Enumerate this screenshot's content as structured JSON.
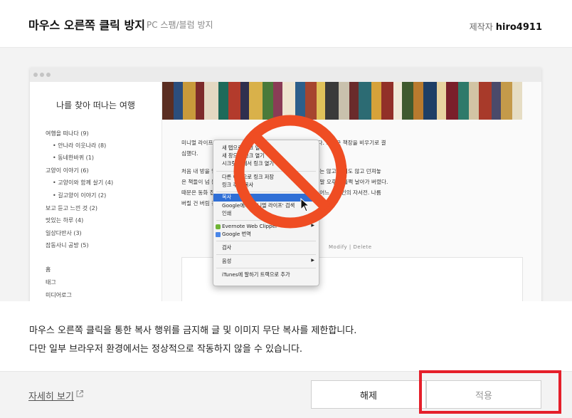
{
  "header": {
    "title": "마우스 오른쪽 클릭 방지",
    "subtitle": "PC 스팸/블럼 방지",
    "author_label": "제작자",
    "author_name": "hiro4911"
  },
  "preview": {
    "blog_title": "나를 찾아 떠나는 여행",
    "categories": [
      "여행을 떠나다 (9)",
      "• 안나라 이웃나라 (8)",
      "• 동네한바퀴 (1)",
      "고양이 이야기 (6)",
      "• 고양이와 함께 살기 (4)",
      "• 길고양이 이야기 (2)",
      "보고 듣고 느낀 것 (2)",
      "맛있는 하루 (4)",
      "일상다반사 (3)",
      "잡동사니 공방 (5)"
    ],
    "nav": [
      "홈",
      "태그",
      "미디어로그"
    ],
    "paragraph_lines": [
      "미니멀 라이프                                    고자 청소하는 과정을 하나하나 남겨놓을까 한다. 오늘은 책장을 비우기로 결",
      "심했다.",
      "처음 내 방을                                  인 오        서재의 이미지였을 텐데. 몇 년간 정리하지는 않고 읽지도 않고 던져놓",
      "은 책들이 넘                                   는 가        로 책을 한 권 두 권 꺼내 분류하다 보니 주말 오후가 훌쩍 날아가 버렸다.",
      "때문은 동화                                         집 숙후감 숙제 때문에 한 번 읽고 펼쳐보지 않은 어느 유명인의 자서전. 나름",
      "버릴 건 버림                                    검           좀 더 많을 줄이야."
    ],
    "modify_delete": "Modify  |  Delete",
    "context_menu": [
      {
        "label": "새 탭으로 링크 열기",
        "selected": false,
        "arrow": false
      },
      {
        "label": "새 창으로 링크 열기",
        "selected": false,
        "arrow": false
      },
      {
        "label": "시크릿 창에서 링크 열기",
        "selected": false,
        "arrow": false
      },
      {
        "label": "다른 이름으로 링크 저장",
        "selected": false,
        "arrow": false
      },
      {
        "label": "링크 주소 복사",
        "selected": false,
        "arrow": false
      },
      {
        "label": "복사",
        "selected": true,
        "arrow": false
      },
      {
        "label": "Google에서 '미니멀 라이프' 검색",
        "selected": false,
        "arrow": false
      },
      {
        "label": "인쇄",
        "selected": false,
        "arrow": false
      },
      {
        "label": "Evernote Web Clipper",
        "selected": false,
        "arrow": true
      },
      {
        "label": "Google 번역",
        "selected": false,
        "arrow": false
      },
      {
        "label": "검사",
        "selected": false,
        "arrow": false
      },
      {
        "label": "음성",
        "selected": false,
        "arrow": true
      },
      {
        "label": "iTunes에 말하기 트랙으로 추가",
        "selected": false,
        "arrow": false
      }
    ]
  },
  "description": {
    "line1": "마우스 오른쪽 클릭을 통한 복사 행위를 금지해 글 및 이미지 무단 복사를 제한합니다.",
    "line2": "다만 일부 브라우저 환경에서는 정상적으로 작동하지 않을 수 있습니다."
  },
  "footer": {
    "detail_link": "자세히 보기",
    "release_button": "해제",
    "apply_button": "적용"
  },
  "colors": {
    "highlight": "#e51f2a",
    "prohibit": "#ef4d23",
    "menu_selected": "#2f6fd6"
  },
  "icons": [
    "external-link-icon",
    "prohibit-icon",
    "cursor-icon",
    "evernote-icon",
    "google-translate-icon"
  ]
}
